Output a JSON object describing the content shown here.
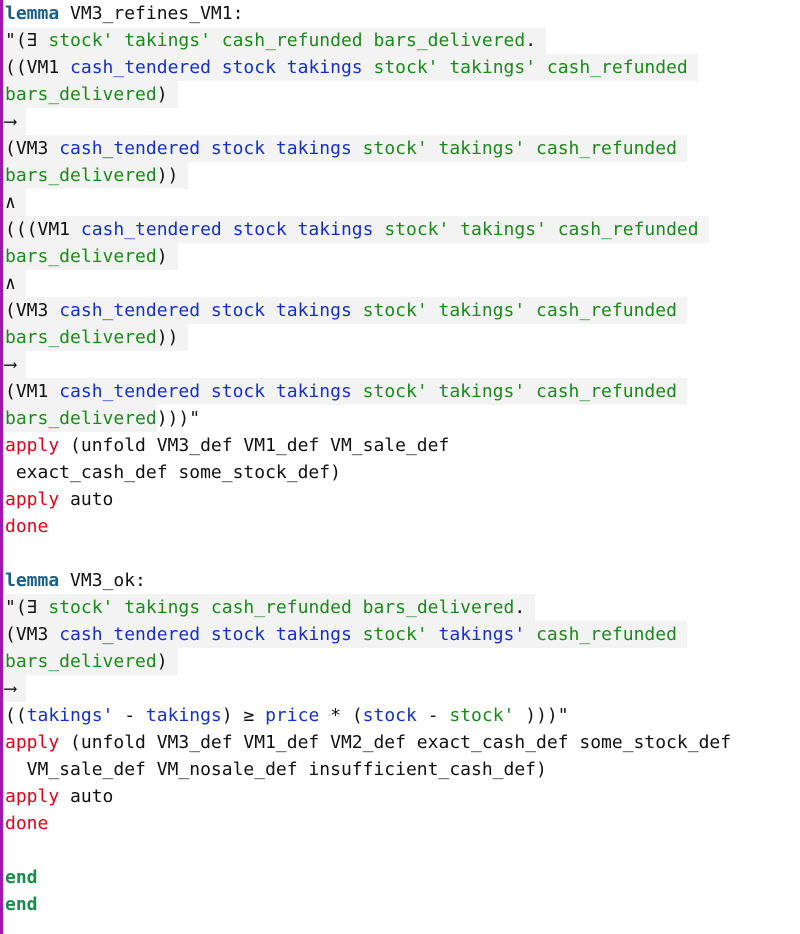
{
  "theme": {
    "keyword_lemma_color": "#1a5f8a",
    "command_color": "#e2001a",
    "end_color": "#178c4b",
    "free_var_color": "#1530c8",
    "bound_var_color": "#1a8a1a",
    "highlight_bg": "#f3f3f3",
    "left_bar_color": "#9b1aa8"
  },
  "lemma1": {
    "header": {
      "kw": "lemma",
      "name": " VM3_refines_VM1:"
    },
    "l1": {
      "a": "\"(∃ ",
      "b": "stock' takings' cash_refunded bars_delivered",
      "c": "."
    },
    "l2": {
      "a": "((VM1 ",
      "b": "cash_tendered stock takings",
      "c": " ",
      "d": "stock' takings' cash_refunded"
    },
    "l3": {
      "a": "bars_delivered",
      "b": ")"
    },
    "l4": {
      "a": "⟶"
    },
    "l5": {
      "a": "(VM3 ",
      "b": "cash_tendered stock takings",
      "c": " ",
      "d": "stock' takings' cash_refunded"
    },
    "l6": {
      "a": "bars_delivered",
      "b": "))"
    },
    "l7": {
      "a": "∧"
    },
    "l8": {
      "a": "(((VM1 ",
      "b": "cash_tendered stock takings",
      "c": " ",
      "d": "stock' takings' cash_refunded"
    },
    "l9": {
      "a": "bars_delivered",
      "b": ")"
    },
    "l10": {
      "a": "∧"
    },
    "l11": {
      "a": "(VM3 ",
      "b": "cash_tendered stock takings",
      "c": " ",
      "d": "stock' takings' cash_refunded"
    },
    "l12": {
      "a": "bars_delivered",
      "b": "))"
    },
    "l13": {
      "a": "⟶"
    },
    "l14": {
      "a": "(VM1 ",
      "b": "cash_tendered stock takings",
      "c": " ",
      "d": "stock' takings' cash_refunded"
    },
    "l15": {
      "a": "bars_delivered",
      "b": ")))\""
    },
    "apply1": {
      "kw": "apply",
      "rest": " (unfold VM3_def VM1_def VM_sale_def"
    },
    "apply1_cont": " exact_cash_def some_stock_def)",
    "apply2": {
      "kw": "apply",
      "rest": " auto"
    },
    "done": "done"
  },
  "lemma2": {
    "header": {
      "kw": "lemma",
      "name": " VM3_ok:"
    },
    "l1": {
      "a": "\"(∃ ",
      "b": "stock' takings cash_refunded bars_delivered",
      "c": "."
    },
    "l2": {
      "a": "(VM3 ",
      "b": "cash_tendered stock takings",
      "c": " ",
      "d": "stock'",
      "e": " ",
      "f": "takings'",
      "g": " ",
      "h": "cash_refunded"
    },
    "l3": {
      "a": "bars_delivered",
      "b": ")"
    },
    "l4": {
      "a": "⟶"
    },
    "l5": {
      "a": "((",
      "b": "takings'",
      "c": " - ",
      "d": "takings",
      "e": ") ≥ ",
      "f": "price",
      "g": " * (",
      "h": "stock",
      "i": " - ",
      "j": "stock'",
      "k": " )))\""
    },
    "apply1": {
      "kw": "apply",
      "rest": " (unfold VM3_def VM1_def VM2_def exact_cash_def some_stock_def"
    },
    "apply1_cont": "  VM_sale_def VM_nosale_def insufficient_cash_def)",
    "apply2": {
      "kw": "apply",
      "rest": " auto"
    },
    "done": "done"
  },
  "end1": "end",
  "end2": "end"
}
